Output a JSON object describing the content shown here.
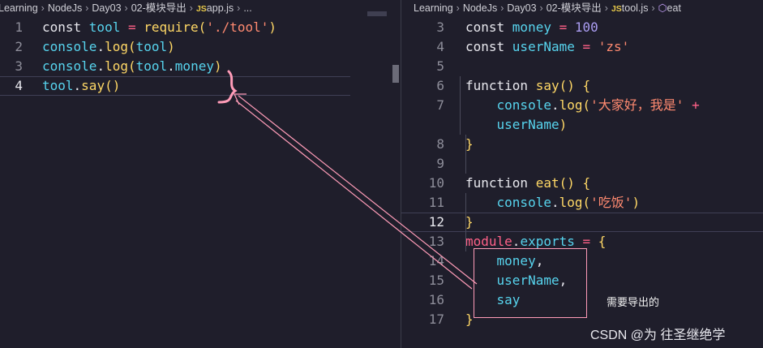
{
  "left": {
    "breadcrumb": [
      "Learning",
      "NodeJs",
      "Day03",
      "02-模块导出",
      "JS",
      "app.js",
      "..."
    ],
    "lines": [
      {
        "n": "1",
        "tokens": [
          [
            "kw",
            "const "
          ],
          [
            "var",
            "tool"
          ],
          [
            "op",
            " = "
          ],
          [
            "fn",
            "require"
          ],
          [
            "paren",
            "("
          ],
          [
            "str",
            "'./tool'"
          ],
          [
            "paren",
            ")"
          ]
        ]
      },
      {
        "n": "2",
        "tokens": [
          [
            "var",
            "console"
          ],
          [
            "plain",
            "."
          ],
          [
            "fn",
            "log"
          ],
          [
            "paren",
            "("
          ],
          [
            "var",
            "tool"
          ],
          [
            "paren",
            ")"
          ]
        ]
      },
      {
        "n": "3",
        "tokens": [
          [
            "var",
            "console"
          ],
          [
            "plain",
            "."
          ],
          [
            "fn",
            "log"
          ],
          [
            "paren",
            "("
          ],
          [
            "var",
            "tool"
          ],
          [
            "plain",
            "."
          ],
          [
            "var",
            "money"
          ],
          [
            "paren",
            ")"
          ]
        ]
      },
      {
        "n": "4",
        "tokens": [
          [
            "var",
            "tool"
          ],
          [
            "plain",
            "."
          ],
          [
            "fn",
            "say"
          ],
          [
            "paren",
            "()"
          ]
        ]
      }
    ]
  },
  "right": {
    "breadcrumb": [
      "Learning",
      "NodeJs",
      "Day03",
      "02-模块导出",
      "JS",
      "tool.js",
      "eat"
    ],
    "lines": [
      {
        "n": "3",
        "tokens": [
          [
            "kw",
            "const "
          ],
          [
            "var",
            "money"
          ],
          [
            "op",
            " = "
          ],
          [
            "num",
            "100"
          ]
        ]
      },
      {
        "n": "4",
        "tokens": [
          [
            "kw",
            "const "
          ],
          [
            "var",
            "userName"
          ],
          [
            "op",
            " = "
          ],
          [
            "str",
            "'zs'"
          ]
        ]
      },
      {
        "n": "5",
        "tokens": []
      },
      {
        "n": "6",
        "tokens": [
          [
            "kw",
            "function "
          ],
          [
            "fn",
            "say"
          ],
          [
            "paren",
            "() {"
          ]
        ]
      },
      {
        "n": "7",
        "tokens": [
          [
            "plain",
            "    "
          ],
          [
            "var",
            "console"
          ],
          [
            "plain",
            "."
          ],
          [
            "fn",
            "log"
          ],
          [
            "paren",
            "("
          ],
          [
            "str",
            "'大家好，我是'"
          ],
          [
            "op",
            " +"
          ]
        ]
      },
      {
        "n": "",
        "tokens": [
          [
            "plain",
            "    "
          ],
          [
            "var",
            "userName"
          ],
          [
            "paren",
            ")"
          ]
        ]
      },
      {
        "n": "8",
        "tokens": [
          [
            "paren",
            "}"
          ]
        ]
      },
      {
        "n": "9",
        "tokens": []
      },
      {
        "n": "10",
        "tokens": [
          [
            "kw",
            "function "
          ],
          [
            "fn",
            "eat"
          ],
          [
            "paren",
            "() {"
          ]
        ]
      },
      {
        "n": "11",
        "tokens": [
          [
            "plain",
            "    "
          ],
          [
            "var",
            "console"
          ],
          [
            "plain",
            "."
          ],
          [
            "fn",
            "log"
          ],
          [
            "paren",
            "("
          ],
          [
            "str",
            "'吃饭'"
          ],
          [
            "paren",
            ")"
          ]
        ]
      },
      {
        "n": "12",
        "tokens": [
          [
            "paren",
            "}"
          ]
        ]
      },
      {
        "n": "13",
        "tokens": [
          [
            "mod",
            "module"
          ],
          [
            "plain",
            "."
          ],
          [
            "var",
            "exports"
          ],
          [
            "op",
            " = "
          ],
          [
            "paren",
            "{"
          ]
        ]
      },
      {
        "n": "14",
        "tokens": [
          [
            "plain",
            "    "
          ],
          [
            "var",
            "money"
          ],
          [
            "plain",
            ","
          ]
        ]
      },
      {
        "n": "15",
        "tokens": [
          [
            "plain",
            "    "
          ],
          [
            "var",
            "userName"
          ],
          [
            "plain",
            ","
          ]
        ]
      },
      {
        "n": "16",
        "tokens": [
          [
            "plain",
            "    "
          ],
          [
            "var",
            "say"
          ]
        ]
      },
      {
        "n": "17",
        "tokens": [
          [
            "paren",
            "}"
          ]
        ]
      }
    ]
  },
  "annotation": {
    "note": "需要导出的",
    "color": "#ff9cb8"
  },
  "watermark": "CSDN @为 往圣继绝学",
  "colors": {
    "background": "#1f1e2b",
    "keyword": "#e8e8ee",
    "variable": "#57d4ee",
    "function": "#ffd866",
    "string": "#ff8a70",
    "operator": "#ff6188",
    "number": "#ab9df2"
  }
}
